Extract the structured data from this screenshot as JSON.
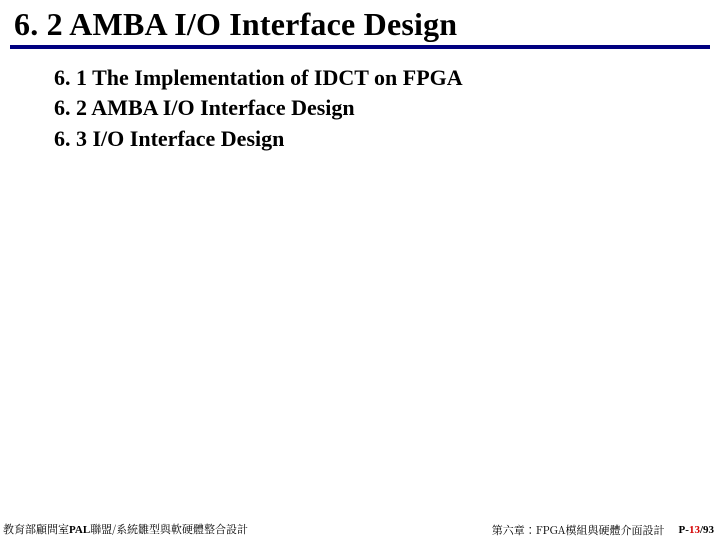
{
  "title": "6. 2 AMBA I/O Interface Design",
  "toc": [
    "6. 1 The Implementation of IDCT on FPGA",
    "6. 2 AMBA I/O Interface Design",
    "6. 3 I/O Interface Design"
  ],
  "footer": {
    "left_prefix": "教育部顧問室",
    "left_pal": "PAL",
    "left_suffix": "聯盟/系統雛型與軟硬體整合設計",
    "center_prefix": "第六章：",
    "center_fpga": "FPGA",
    "center_suffix": "模組與硬體介面設計",
    "page_prefix": "P-",
    "page_current": "13",
    "page_sep": "/",
    "page_total": "93"
  }
}
